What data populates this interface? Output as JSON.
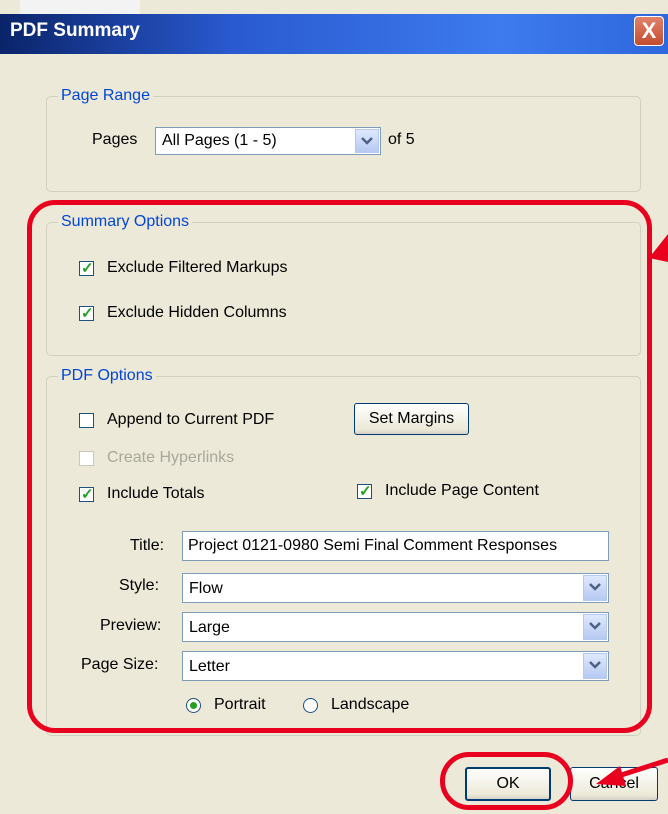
{
  "window": {
    "title": "PDF Summary",
    "close_glyph": "X"
  },
  "page_range": {
    "group_label": "Page Range",
    "pages_label": "Pages",
    "pages_value": "All Pages (1 - 5)",
    "of_label": "of 5"
  },
  "summary_options": {
    "group_label": "Summary Options",
    "exclude_filtered": {
      "label": "Exclude Filtered Markups",
      "checked": true
    },
    "exclude_hidden": {
      "label": "Exclude Hidden Columns",
      "checked": true
    }
  },
  "pdf_options": {
    "group_label": "PDF Options",
    "append_current": {
      "label": "Append to Current PDF",
      "checked": false
    },
    "set_margins_label": "Set Margins",
    "create_hyperlinks": {
      "label": "Create Hyperlinks",
      "checked": false,
      "disabled": true
    },
    "include_totals": {
      "label": "Include Totals",
      "checked": true
    },
    "include_page_content": {
      "label": "Include Page Content",
      "checked": true
    },
    "title_label": "Title:",
    "title_value": "Project 0121-0980 Semi Final Comment Responses",
    "style_label": "Style:",
    "style_value": "Flow",
    "preview_label": "Preview:",
    "preview_value": "Large",
    "page_size_label": "Page Size:",
    "page_size_value": "Letter",
    "orientation": {
      "portrait_label": "Portrait",
      "landscape_label": "Landscape",
      "selected": "Portrait"
    }
  },
  "buttons": {
    "ok_label": "OK",
    "cancel_label": "Cancel"
  },
  "colors": {
    "annotation_red": "#e8001e",
    "group_title_blue": "#0046d5",
    "check_green": "#21a121"
  }
}
